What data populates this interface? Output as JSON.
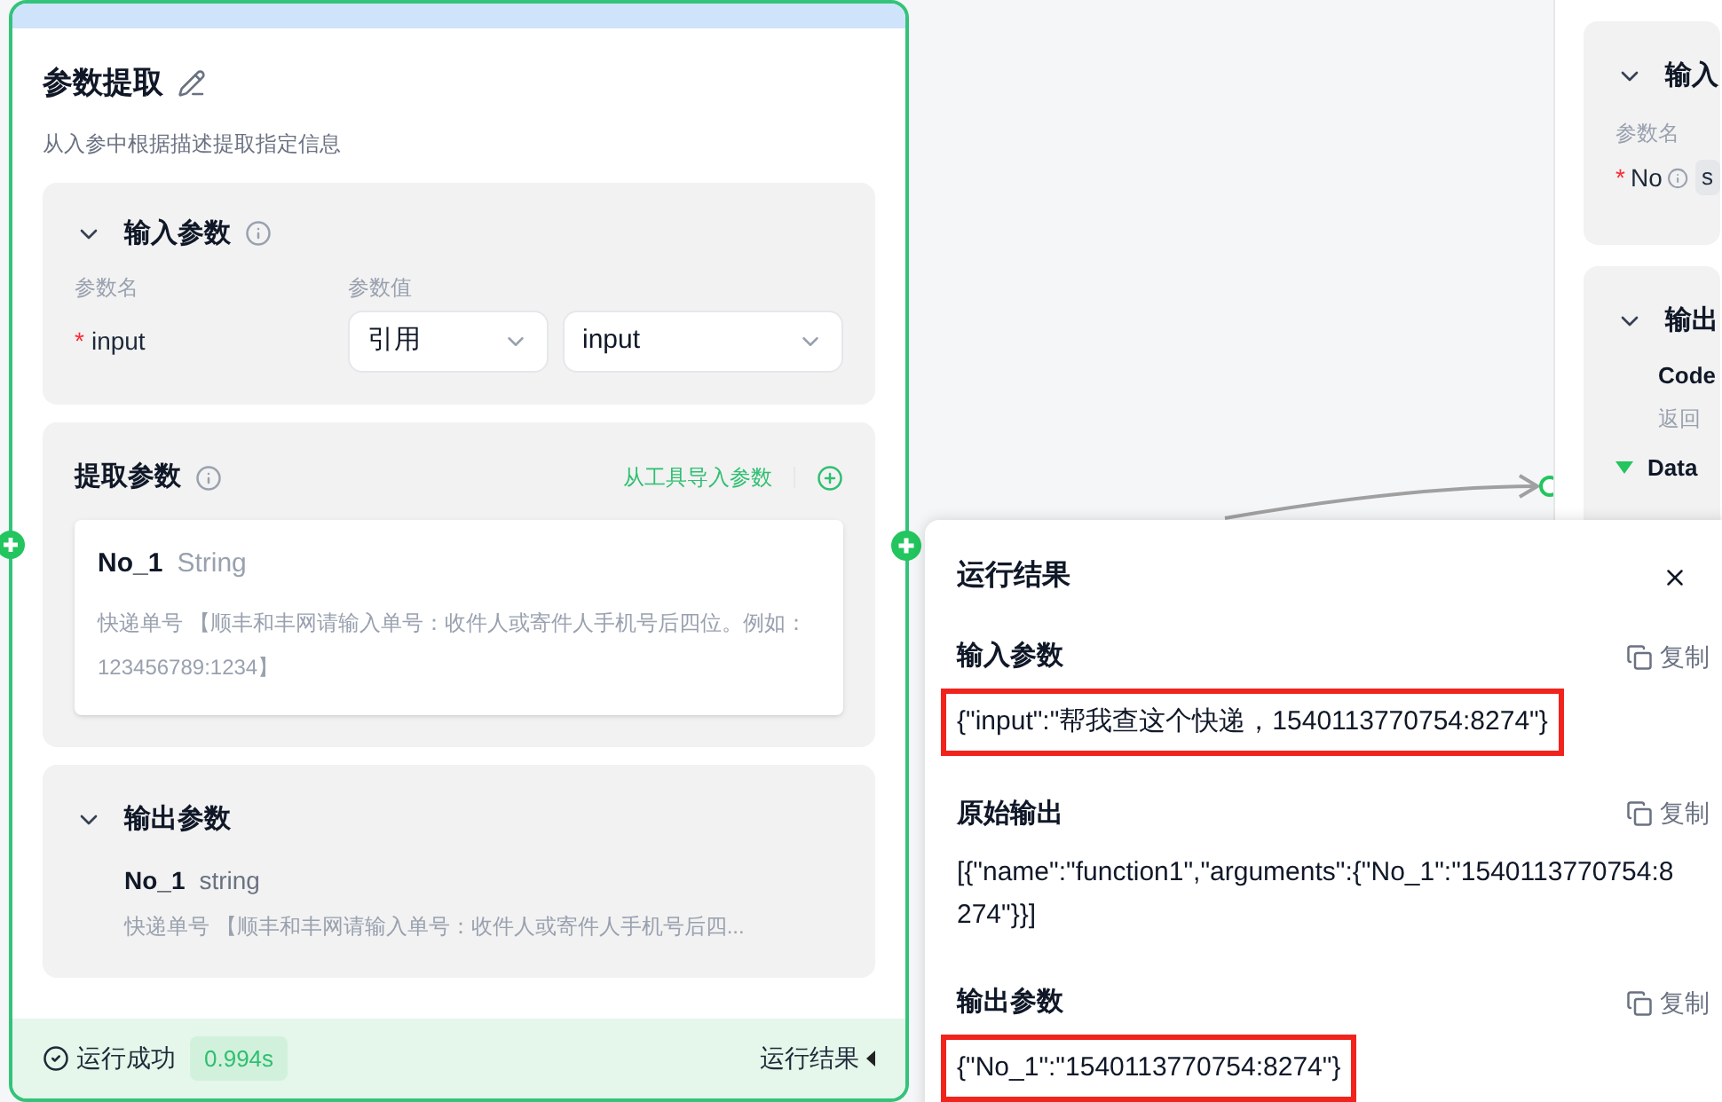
{
  "node": {
    "title": "参数提取",
    "description": "从入参中根据描述提取指定信息",
    "input_section": {
      "title": "输入参数",
      "expanded": true,
      "name_header": "参数名",
      "value_header": "参数值",
      "params": [
        {
          "name": "input",
          "required_mark": "*",
          "source": "引用",
          "value": "input"
        }
      ]
    },
    "extract_section": {
      "title": "提取参数",
      "import_link": "从工具导入参数",
      "params": [
        {
          "name": "No_1",
          "type": "String",
          "description": "快递单号 【顺丰和丰网请输入单号：收件人或寄件人手机号后四位。例如：123456789:1234】"
        }
      ]
    },
    "output_section": {
      "title": "输出参数",
      "expanded": true,
      "params": [
        {
          "name": "No_1",
          "type": "string",
          "description": "快递单号 【顺丰和丰网请输入单号：收件人或寄件人手机号后四..."
        }
      ]
    },
    "footer": {
      "status": "运行成功",
      "duration": "0.994s",
      "result_link": "运行结果"
    }
  },
  "result_panel": {
    "title": "运行结果",
    "sections": [
      {
        "title": "输入参数",
        "copy": "复制",
        "content": "{\"input\":\"帮我查这个快递，1540113770754:8274\"}",
        "highlighted": true
      },
      {
        "title": "原始输出",
        "copy": "复制",
        "content": "[{\"name\":\"function1\",\"arguments\":{\"No_1\":\"1540113770754:8274\"}}]",
        "highlighted": false
      },
      {
        "title": "输出参数",
        "copy": "复制",
        "content": "{\"No_1\":\"1540113770754:8274\"}",
        "highlighted": true
      }
    ]
  },
  "right_node": {
    "input_section": {
      "title": "输入",
      "expanded": true,
      "name_header": "参数名",
      "params": [
        {
          "name": "No",
          "required_mark": "*",
          "type": "s"
        }
      ]
    },
    "output_section": {
      "title": "输出",
      "expanded": true,
      "fields": [
        {
          "name": "Code",
          "description": "返回"
        },
        {
          "name": "Data",
          "expanded": true
        }
      ]
    }
  }
}
